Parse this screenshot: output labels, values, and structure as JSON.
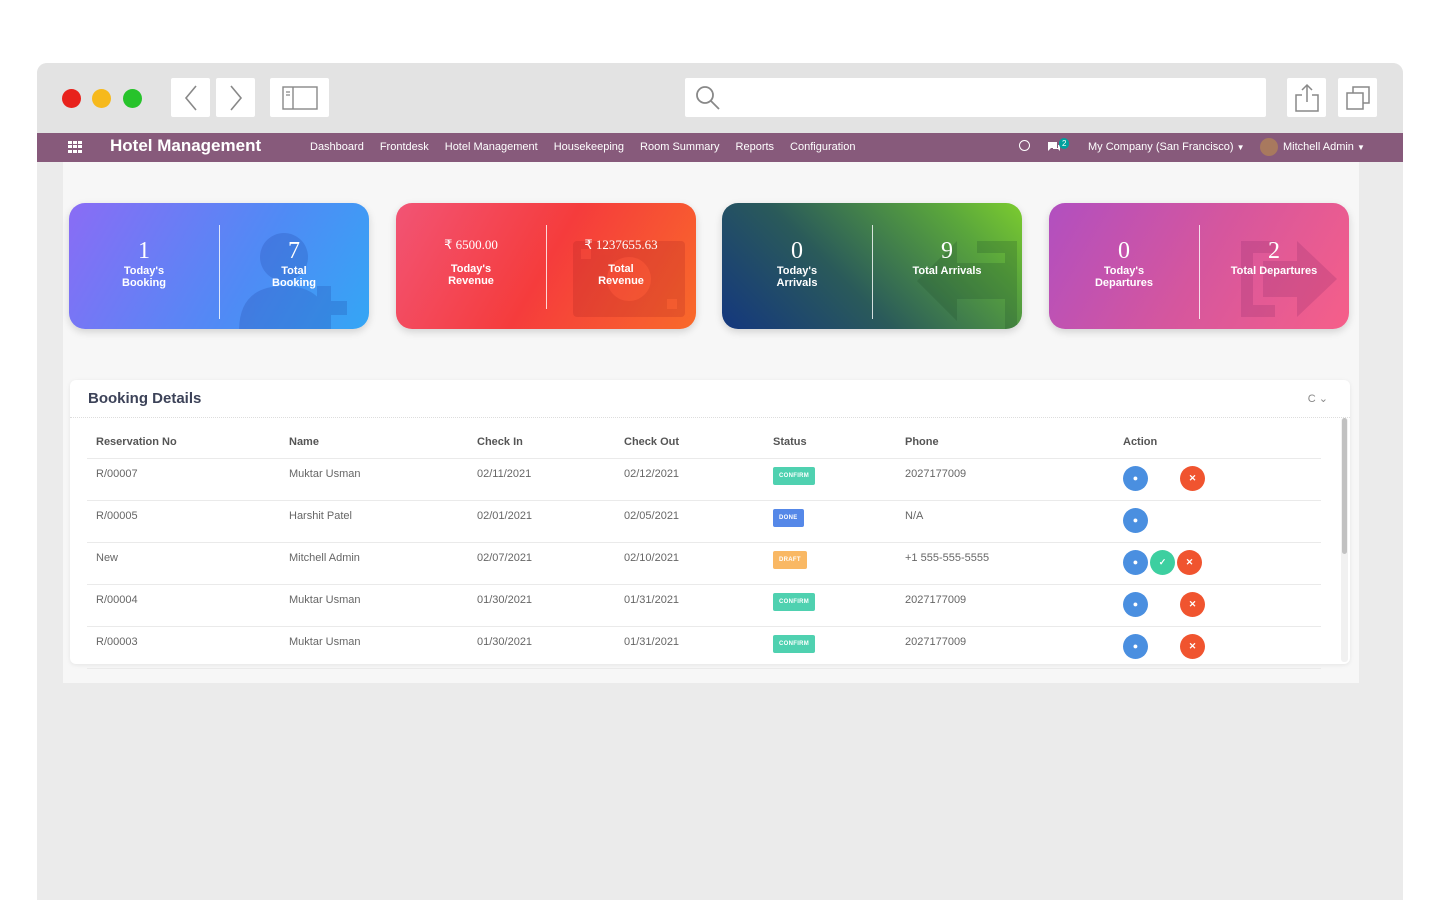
{
  "navbar": {
    "brand": "Hotel Management",
    "menu": [
      "Dashboard",
      "Frontdesk",
      "Hotel Management",
      "Housekeeping",
      "Room Summary",
      "Reports",
      "Configuration"
    ],
    "chat_count": "2",
    "company": "My Company (San Francisco)",
    "user": "Mitchell Admin"
  },
  "cards": [
    {
      "left": {
        "value": "1",
        "label": "Today's Booking"
      },
      "right": {
        "value": "7",
        "label": "Total Booking"
      },
      "icon": "add-user-icon"
    },
    {
      "left": {
        "value": "₹ 6500.00",
        "label": "Today's Revenue"
      },
      "right": {
        "value": "₹ 1237655.63",
        "label": "Total Revenue"
      },
      "icon": "money-icon"
    },
    {
      "left": {
        "value": "0",
        "label": "Today's Arrivals"
      },
      "right": {
        "value": "9",
        "label": "Total Arrivals"
      },
      "icon": "sign-in-icon"
    },
    {
      "left": {
        "value": "0",
        "label": "Today's Departures"
      },
      "right": {
        "value": "2",
        "label": "Total Departures"
      },
      "icon": "sign-out-icon"
    }
  ],
  "booking": {
    "title": "Booking Details",
    "controls": "C ⌄",
    "columns": [
      "Reservation No",
      "Name",
      "Check In",
      "Check Out",
      "Status",
      "Phone",
      "Action"
    ],
    "rows": [
      {
        "res": "R/00007",
        "name": "Muktar Usman",
        "in": "02/11/2021",
        "out": "02/12/2021",
        "status": "confirm",
        "phone": "2027177009",
        "actions": [
          "view",
          "cancel"
        ]
      },
      {
        "res": "R/00005",
        "name": "Harshit Patel",
        "in": "02/01/2021",
        "out": "02/05/2021",
        "status": "done",
        "phone": "N/A",
        "actions": [
          "view"
        ]
      },
      {
        "res": "New",
        "name": "Mitchell Admin",
        "in": "02/07/2021",
        "out": "02/10/2021",
        "status": "draft",
        "phone": "+1 555-555-5555",
        "actions": [
          "view",
          "ok",
          "cancel"
        ]
      },
      {
        "res": "R/00004",
        "name": "Muktar Usman",
        "in": "01/30/2021",
        "out": "01/31/2021",
        "status": "confirm",
        "phone": "2027177009",
        "actions": [
          "view",
          "cancel"
        ]
      },
      {
        "res": "R/00003",
        "name": "Muktar Usman",
        "in": "01/30/2021",
        "out": "01/31/2021",
        "status": "confirm",
        "phone": "2027177009",
        "actions": [
          "view",
          "cancel"
        ]
      }
    ]
  },
  "colors": {
    "navbar": "#875a7b",
    "confirm": "#4fd1b0",
    "done": "#5588e8",
    "draft": "#f9b864",
    "view_button": "#4a8fe0",
    "cancel_button": "#f0542f",
    "ok_button": "#3dcfa0"
  }
}
